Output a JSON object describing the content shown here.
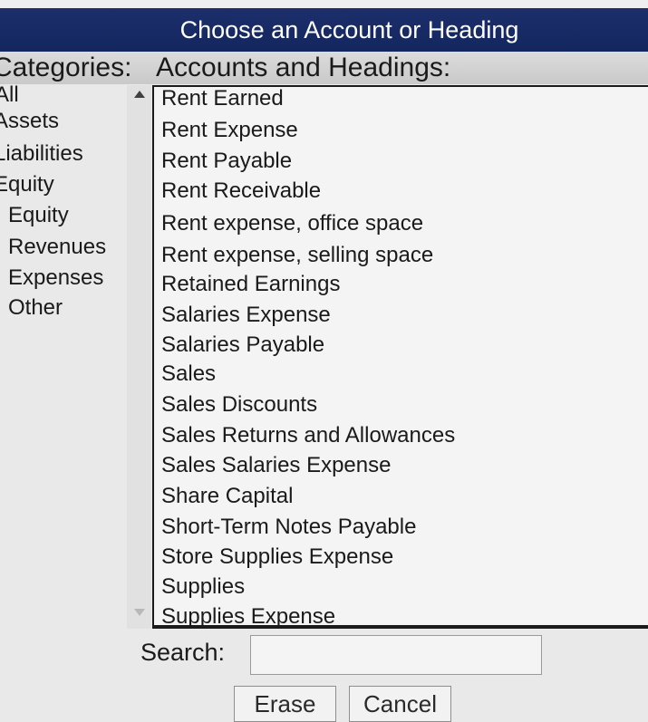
{
  "dialog": {
    "title": "Choose an Account or Heading"
  },
  "categories": {
    "header": "Categories:",
    "items": [
      {
        "label": "All"
      },
      {
        "label": "Assets"
      },
      {
        "label": "Liabilities"
      },
      {
        "label": "Equity"
      },
      {
        "label": "Equity"
      },
      {
        "label": "Revenues"
      },
      {
        "label": "Expenses"
      },
      {
        "label": "Other"
      }
    ]
  },
  "accounts": {
    "header": "Accounts and Headings:",
    "items": [
      {
        "label": "Rent Earned"
      },
      {
        "label": "Rent Expense"
      },
      {
        "label": "Rent Payable"
      },
      {
        "label": "Rent Receivable"
      },
      {
        "label": "Rent expense, office space"
      },
      {
        "label": "Rent expense, selling space"
      },
      {
        "label": "Retained Earnings"
      },
      {
        "label": "Salaries Expense"
      },
      {
        "label": "Salaries Payable"
      },
      {
        "label": "Sales"
      },
      {
        "label": "Sales Discounts"
      },
      {
        "label": "Sales Returns and Allowances"
      },
      {
        "label": "Sales Salaries Expense"
      },
      {
        "label": "Share Capital"
      },
      {
        "label": "Short-Term Notes Payable"
      },
      {
        "label": "Store Supplies Expense"
      },
      {
        "label": "Supplies"
      },
      {
        "label": "Supplies Expense"
      }
    ]
  },
  "search": {
    "label": "Search:",
    "value": ""
  },
  "buttons": {
    "erase": "Erase",
    "cancel": "Cancel"
  },
  "colors": {
    "title_bar": "#1d2f6b",
    "title_text": "#ffffff",
    "background": "#e9e9e9"
  }
}
